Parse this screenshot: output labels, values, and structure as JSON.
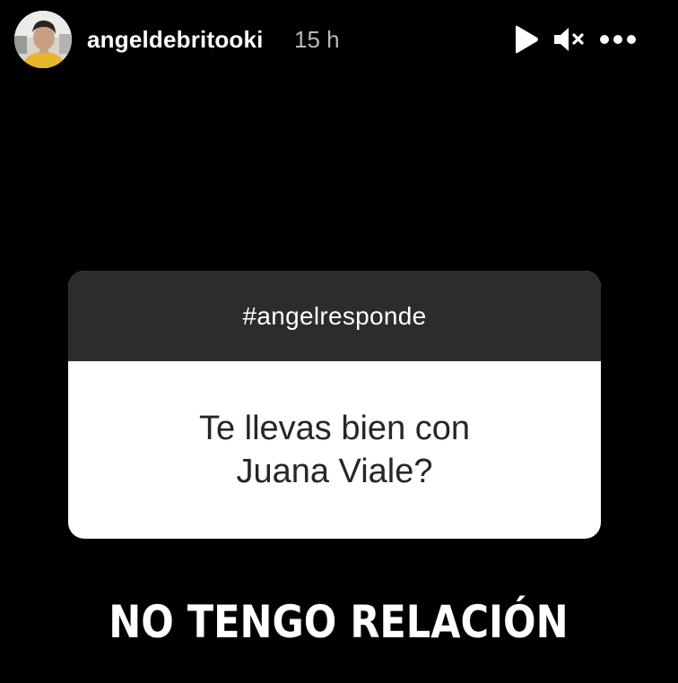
{
  "header": {
    "username": "angeldebritooki",
    "timestamp": "15 h",
    "avatar_icon": "user-avatar",
    "controls": {
      "play_icon": "play-icon",
      "mute_icon": "mute-icon",
      "more_icon": "more-options-icon"
    }
  },
  "sticker": {
    "tag": "#angelresponde",
    "question_line1": "Te llevas bien con",
    "question_line2": "Juana Viale?"
  },
  "caption": "NO TENGO RELACIÓN",
  "colors": {
    "background": "#000000",
    "sticker_header": "#2c2c2c",
    "sticker_body": "#ffffff",
    "question_text": "#262626",
    "timestamp_text": "#b9b9b9"
  }
}
